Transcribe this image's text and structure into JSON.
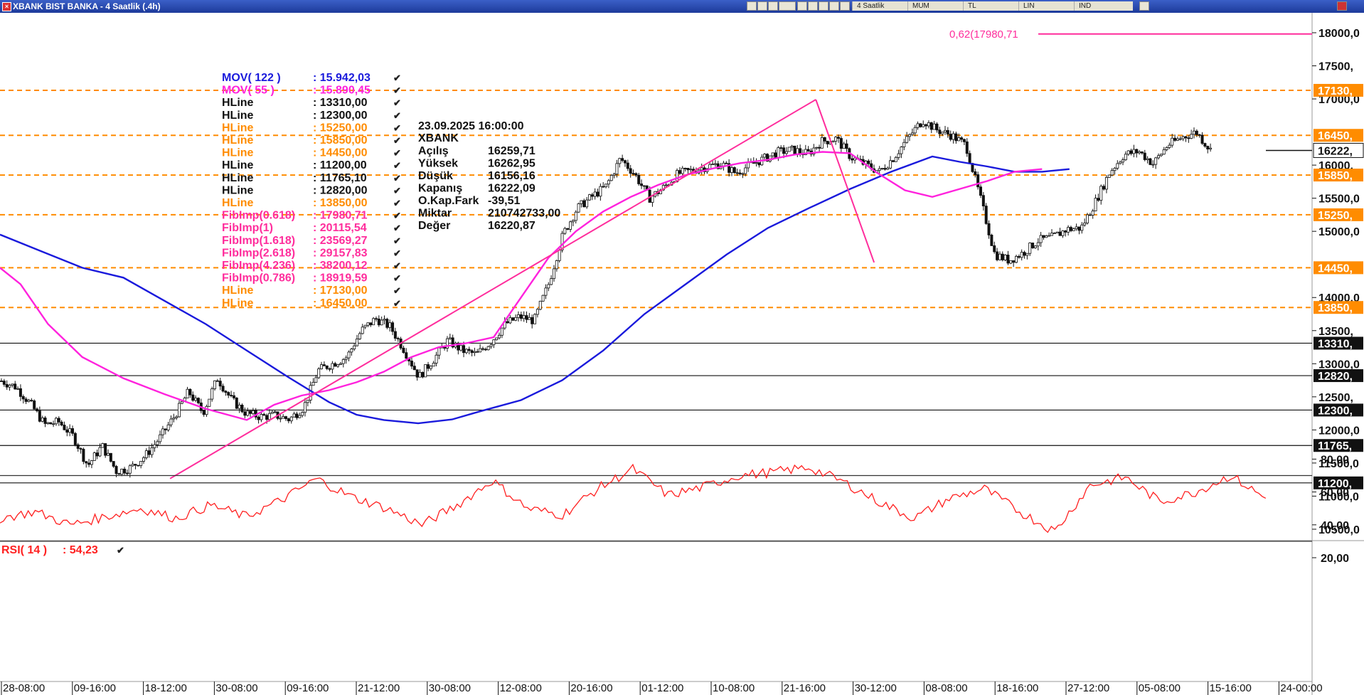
{
  "window": {
    "title": "XBANK BIST BANKA - 4 Saatlik (.4h)"
  },
  "toolbar": {
    "period": "4 Saatlik",
    "style": "MUM",
    "currency": "TL",
    "scale": "LIN",
    "mode": "IND"
  },
  "colors": {
    "blue": "#1a1adc",
    "magenta": "#ff22dd",
    "orange": "#ff8c00",
    "black": "#111111",
    "fib": "#ff2d9c",
    "rsi": "#ff2020",
    "rsiLevel": "#333333"
  },
  "legend": [
    {
      "name": "MOV( 122 )",
      "value": ": 15.942,03",
      "color": "#1a1adc"
    },
    {
      "name": "MOV( 55 )",
      "value": ": 15.890,45",
      "color": "#ff22dd"
    },
    {
      "name": "HLine",
      "value": ": 13310,00",
      "color": "#111111"
    },
    {
      "name": "HLine",
      "value": ": 12300,00",
      "color": "#111111"
    },
    {
      "name": "HLine",
      "value": ": 15250,00",
      "color": "#ff8c00"
    },
    {
      "name": "HLine",
      "value": ": 15850,00",
      "color": "#ff8c00"
    },
    {
      "name": "HLine",
      "value": ": 14450,00",
      "color": "#ff8c00"
    },
    {
      "name": "HLine",
      "value": ": 11200,00",
      "color": "#111111"
    },
    {
      "name": "HLine",
      "value": ": 11765,10",
      "color": "#111111"
    },
    {
      "name": "HLine",
      "value": ": 12820,00",
      "color": "#111111"
    },
    {
      "name": "HLine",
      "value": ": 13850,00",
      "color": "#ff8c00"
    },
    {
      "name": "FibImp(0.618)",
      "value": ": 17980,71",
      "color": "#ff2d9c"
    },
    {
      "name": "FibImp(1)",
      "value": ": 20115,54",
      "color": "#ff2d9c"
    },
    {
      "name": "FibImp(1.618)",
      "value": ": 23569,27",
      "color": "#ff2d9c"
    },
    {
      "name": "FibImp(2.618)",
      "value": ": 29157,83",
      "color": "#ff2d9c"
    },
    {
      "name": "FibImp(4.236)",
      "value": ": 38200,12",
      "color": "#ff2d9c"
    },
    {
      "name": "FibImp(0.786)",
      "value": ": 18919,59",
      "color": "#ff2d9c"
    },
    {
      "name": "HLine",
      "value": ": 17130,00",
      "color": "#ff8c00"
    },
    {
      "name": "HLine",
      "value": ": 16450,00",
      "color": "#ff8c00"
    }
  ],
  "info": {
    "datetime": "23.09.2025  16:00:00",
    "symbol": "XBANK",
    "rows": [
      {
        "label": "Açılış",
        "value": "16259,71"
      },
      {
        "label": "Yüksek",
        "value": "16262,95"
      },
      {
        "label": "Düşük",
        "value": "16156,16"
      },
      {
        "label": "Kapanış",
        "value": "16222,09"
      },
      {
        "label": "O.Kap.Fark",
        "value": "-39,51"
      },
      {
        "label": "Miktar",
        "value": "210742733,00"
      },
      {
        "label": "Değer",
        "value": "16220,87"
      }
    ]
  },
  "fib_label": "0,62(17980,71",
  "rsi_legend": {
    "name": "RSI( 14 )",
    "value": ": 54,23"
  },
  "chart_data": {
    "type": "candlestick",
    "price_axis": {
      "ticks": [
        18000,
        17500,
        17000,
        16000,
        15500,
        15000,
        14000,
        13500,
        13000,
        12500,
        12000,
        11500,
        11000,
        10500
      ],
      "tick_labels": [
        "18000,0",
        "17500,",
        "17000,0",
        "16000,",
        "15500,0",
        "15000,0",
        "14000,0",
        "13500,",
        "13000,0",
        "12500,",
        "12000,0",
        "11500,0",
        "11000,0",
        "10500,0"
      ]
    },
    "hlines": [
      {
        "value": 17130,
        "label": "17130,",
        "color": "#ff8c00",
        "style": "dashed"
      },
      {
        "value": 16450,
        "label": "16450,",
        "color": "#ff8c00",
        "style": "dashed"
      },
      {
        "value": 15850,
        "label": "15850,",
        "color": "#ff8c00",
        "style": "dashed"
      },
      {
        "value": 15250,
        "label": "15250,",
        "color": "#ff8c00",
        "style": "dashed"
      },
      {
        "value": 14450,
        "label": "14450,",
        "color": "#ff8c00",
        "style": "dashed"
      },
      {
        "value": 13850,
        "label": "13850,",
        "color": "#ff8c00",
        "style": "dashed"
      },
      {
        "value": 13310,
        "label": "13310,",
        "color": "#111111",
        "style": "solid"
      },
      {
        "value": 12820,
        "label": "12820,",
        "color": "#111111",
        "style": "solid"
      },
      {
        "value": 12300,
        "label": "12300,",
        "color": "#111111",
        "style": "solid"
      },
      {
        "value": 11765.1,
        "label": "11765,",
        "color": "#111111",
        "style": "solid"
      },
      {
        "value": 11200,
        "label": "11200,",
        "color": "#111111",
        "style": "solid"
      }
    ],
    "fib_line": {
      "value": 17980.71
    },
    "last_price": {
      "value": 16222.09,
      "label": "16222,"
    },
    "x_labels": [
      "28-08:00",
      "09-16:00",
      "18-12:00",
      "30-08:00",
      "09-16:00",
      "21-12:00",
      "30-08:00",
      "12-08:00",
      "20-16:00",
      "01-12:00",
      "10-08:00",
      "21-16:00",
      "30-12:00",
      "08-08:00",
      "18-16:00",
      "27-12:00",
      "05-08:00",
      "15-16:00",
      "24-00:00"
    ],
    "close_path": [
      [
        0,
        12740
      ],
      [
        10,
        12650
      ],
      [
        20,
        12400
      ],
      [
        30,
        12080
      ],
      [
        40,
        12120
      ],
      [
        50,
        11900
      ],
      [
        60,
        11460
      ],
      [
        70,
        11760
      ],
      [
        80,
        11370
      ],
      [
        90,
        11430
      ],
      [
        100,
        11610
      ],
      [
        110,
        11880
      ],
      [
        120,
        12200
      ],
      [
        130,
        12580
      ],
      [
        140,
        12260
      ],
      [
        150,
        12780
      ],
      [
        160,
        12450
      ],
      [
        170,
        12250
      ],
      [
        180,
        12200
      ],
      [
        190,
        12220
      ],
      [
        200,
        12160
      ],
      [
        210,
        12340
      ],
      [
        220,
        12900
      ],
      [
        230,
        13000
      ],
      [
        240,
        13100
      ],
      [
        250,
        13500
      ],
      [
        260,
        13680
      ],
      [
        270,
        13560
      ],
      [
        280,
        13200
      ],
      [
        290,
        12800
      ],
      [
        300,
        13060
      ],
      [
        310,
        13350
      ],
      [
        320,
        13200
      ],
      [
        330,
        13140
      ],
      [
        340,
        13330
      ],
      [
        350,
        13600
      ],
      [
        360,
        13710
      ],
      [
        370,
        13650
      ],
      [
        380,
        14200
      ],
      [
        390,
        14950
      ],
      [
        400,
        15350
      ],
      [
        410,
        15520
      ],
      [
        420,
        15680
      ],
      [
        430,
        16100
      ],
      [
        440,
        15860
      ],
      [
        450,
        15500
      ],
      [
        460,
        15660
      ],
      [
        470,
        15870
      ],
      [
        480,
        15920
      ],
      [
        490,
        15980
      ],
      [
        500,
        16020
      ],
      [
        510,
        15880
      ],
      [
        520,
        16000
      ],
      [
        530,
        16100
      ],
      [
        540,
        16200
      ],
      [
        550,
        16230
      ],
      [
        560,
        16170
      ],
      [
        570,
        16360
      ],
      [
        580,
        16400
      ],
      [
        590,
        16120
      ],
      [
        600,
        16010
      ],
      [
        610,
        15900
      ],
      [
        620,
        16120
      ],
      [
        630,
        16420
      ],
      [
        640,
        16680
      ],
      [
        650,
        16530
      ],
      [
        660,
        16450
      ],
      [
        670,
        16300
      ],
      [
        680,
        15500
      ],
      [
        690,
        14650
      ],
      [
        700,
        14560
      ],
      [
        710,
        14680
      ],
      [
        720,
        14860
      ],
      [
        730,
        14910
      ],
      [
        740,
        15030
      ],
      [
        750,
        15050
      ],
      [
        760,
        15450
      ],
      [
        770,
        15900
      ],
      [
        780,
        16160
      ],
      [
        790,
        16210
      ],
      [
        800,
        16020
      ],
      [
        810,
        16300
      ],
      [
        820,
        16420
      ],
      [
        830,
        16500
      ],
      [
        840,
        16222
      ]
    ],
    "mov122": [
      [
        0,
        14950
      ],
      [
        60,
        14700
      ],
      [
        120,
        14450
      ],
      [
        180,
        14300
      ],
      [
        240,
        13950
      ],
      [
        300,
        13600
      ],
      [
        360,
        13200
      ],
      [
        420,
        12800
      ],
      [
        480,
        12420
      ],
      [
        520,
        12230
      ],
      [
        560,
        12150
      ],
      [
        610,
        12100
      ],
      [
        660,
        12160
      ],
      [
        700,
        12280
      ],
      [
        760,
        12450
      ],
      [
        820,
        12750
      ],
      [
        880,
        13200
      ],
      [
        940,
        13750
      ],
      [
        1000,
        14200
      ],
      [
        1060,
        14650
      ],
      [
        1120,
        15050
      ],
      [
        1180,
        15350
      ],
      [
        1240,
        15640
      ],
      [
        1300,
        15900
      ],
      [
        1360,
        16130
      ],
      [
        1400,
        16050
      ],
      [
        1440,
        15980
      ],
      [
        1480,
        15900
      ],
      [
        1520,
        15900
      ],
      [
        1560,
        15940
      ]
    ],
    "mov55": [
      [
        0,
        14450
      ],
      [
        30,
        14200
      ],
      [
        70,
        13600
      ],
      [
        120,
        13100
      ],
      [
        180,
        12780
      ],
      [
        240,
        12540
      ],
      [
        300,
        12320
      ],
      [
        360,
        12150
      ],
      [
        400,
        12380
      ],
      [
        440,
        12520
      ],
      [
        480,
        12600
      ],
      [
        520,
        12720
      ],
      [
        560,
        12880
      ],
      [
        600,
        13100
      ],
      [
        640,
        13250
      ],
      [
        680,
        13310
      ],
      [
        720,
        13400
      ],
      [
        760,
        14000
      ],
      [
        800,
        14600
      ],
      [
        840,
        15000
      ],
      [
        880,
        15300
      ],
      [
        920,
        15520
      ],
      [
        960,
        15700
      ],
      [
        1000,
        15850
      ],
      [
        1040,
        15950
      ],
      [
        1080,
        16030
      ],
      [
        1120,
        16080
      ],
      [
        1160,
        16160
      ],
      [
        1200,
        16200
      ],
      [
        1240,
        16180
      ],
      [
        1280,
        15880
      ],
      [
        1320,
        15620
      ],
      [
        1360,
        15520
      ],
      [
        1400,
        15640
      ],
      [
        1440,
        15760
      ],
      [
        1480,
        15900
      ],
      [
        1520,
        15940
      ]
    ],
    "trendlines": [
      {
        "points": [
          [
            248,
            11265
          ],
          [
            1190,
            16990
          ]
        ],
        "color": "#ff2d9c"
      },
      {
        "points": [
          [
            1190,
            16990
          ],
          [
            1275,
            14530
          ]
        ],
        "color": "#ff2d9c"
      }
    ],
    "rsi": {
      "name": "RSI(14)",
      "value": 54.23,
      "levels": [
        70,
        30
      ],
      "ticks": [
        80,
        60,
        40,
        20
      ],
      "tick_labels": [
        "80,00",
        "60,00",
        "40,00",
        "20,00"
      ],
      "path": [
        [
          0,
          44
        ],
        [
          40,
          48
        ],
        [
          80,
          40
        ],
        [
          120,
          45
        ],
        [
          160,
          50
        ],
        [
          200,
          44
        ],
        [
          240,
          52
        ],
        [
          280,
          45
        ],
        [
          320,
          55
        ],
        [
          360,
          68
        ],
        [
          400,
          57
        ],
        [
          440,
          50
        ],
        [
          480,
          40
        ],
        [
          520,
          52
        ],
        [
          560,
          67
        ],
        [
          600,
          50
        ],
        [
          640,
          46
        ],
        [
          680,
          62
        ],
        [
          720,
          74
        ],
        [
          760,
          58
        ],
        [
          800,
          63
        ],
        [
          840,
          70
        ],
        [
          880,
          72
        ],
        [
          920,
          75
        ],
        [
          960,
          66
        ],
        [
          1000,
          54
        ],
        [
          1040,
          44
        ],
        [
          1080,
          56
        ],
        [
          1120,
          62
        ],
        [
          1160,
          48
        ],
        [
          1200,
          36
        ],
        [
          1240,
          64
        ],
        [
          1280,
          69
        ],
        [
          1320,
          54
        ],
        [
          1360,
          60
        ],
        [
          1400,
          70
        ],
        [
          1440,
          56
        ]
      ]
    }
  }
}
